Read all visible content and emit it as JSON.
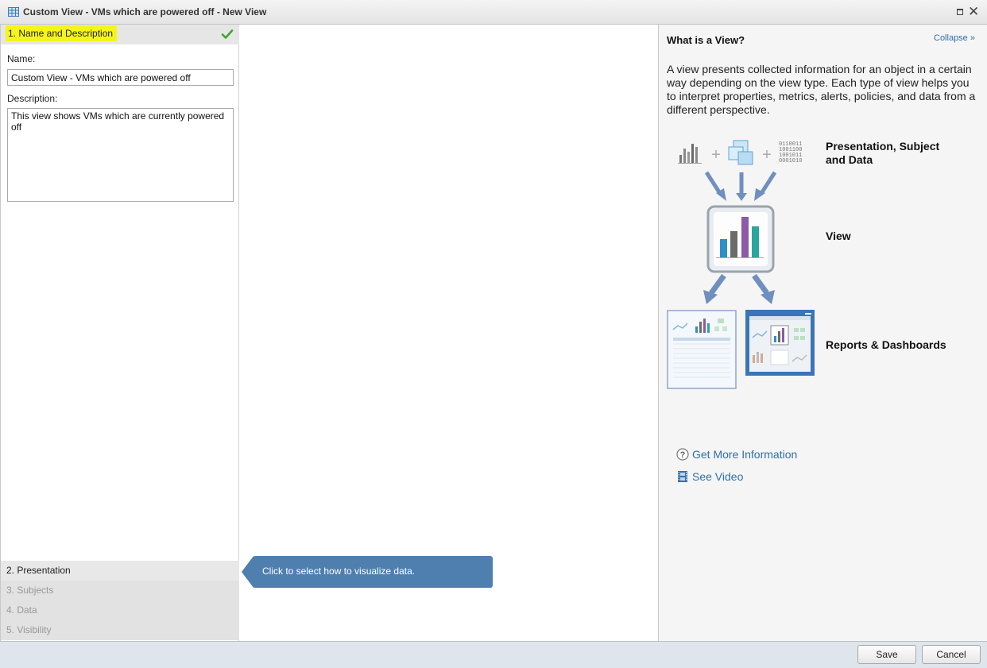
{
  "window": {
    "title": "Custom View - VMs which are powered off - New View"
  },
  "steps": [
    {
      "label": "1. Name and Description",
      "state": "complete"
    },
    {
      "label": "2. Presentation",
      "state": "active"
    },
    {
      "label": "3. Subjects",
      "state": "disabled"
    },
    {
      "label": "4. Data",
      "state": "disabled"
    },
    {
      "label": "5. Visibility",
      "state": "disabled"
    }
  ],
  "form": {
    "name_label": "Name:",
    "name_value": "Custom View - VMs which are powered off",
    "description_label": "Description:",
    "description_value": "This view shows VMs which are currently powered off"
  },
  "tooltip": {
    "text": "Click to select how to visualize data."
  },
  "help": {
    "title": "What is a View?",
    "collapse_label": "Collapse",
    "description": "A view presents collected information for an object in a certain way depending on the view type. Each type of view helps you to interpret properties, metrics, alerts, policies, and data from a different perspective.",
    "diagram": {
      "binary_text": [
        "0110011",
        "1001100",
        "1001011",
        "0001010"
      ],
      "label_inputs": "Presentation, Subject and Data",
      "label_view": "View",
      "label_outputs": "Reports & Dashboards"
    },
    "links": [
      {
        "label": "Get More Information",
        "icon": "question-circle-icon"
      },
      {
        "label": "See Video",
        "icon": "film-icon"
      }
    ]
  },
  "footer": {
    "save_label": "Save",
    "cancel_label": "Cancel"
  },
  "colors": {
    "highlight": "#f5f51a",
    "link": "#2f6fa8",
    "tooltip_bg": "#4e7fae",
    "check": "#3aa832"
  }
}
